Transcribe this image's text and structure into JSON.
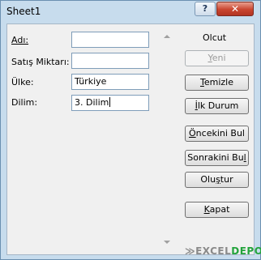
{
  "window": {
    "title": "Sheet1",
    "help_label": "?",
    "close_label": "✕"
  },
  "form": {
    "fields": [
      {
        "label": "Adı:",
        "value": ""
      },
      {
        "label": "Satış Miktarı:",
        "value": ""
      },
      {
        "label": "Ülke:",
        "value": "Türkiye"
      },
      {
        "label": "Dilim:",
        "value": "3. Dilim"
      }
    ]
  },
  "actions": {
    "group_label": "Olcut",
    "buttons": [
      {
        "pre": "",
        "key": "Y",
        "post": "eni",
        "enabled": false
      },
      {
        "pre": "",
        "key": "T",
        "post": "emizle",
        "enabled": true
      },
      {
        "pre": "",
        "key": "İ",
        "post": "lk Durum",
        "enabled": true
      },
      {
        "pre": "",
        "key": "Ö",
        "post": "ncekini Bul",
        "enabled": true
      },
      {
        "pre": "Sonrakini Bu",
        "key": "l",
        "post": "",
        "enabled": true
      },
      {
        "pre": "Olu",
        "key": "ş",
        "post": "tur",
        "enabled": true
      },
      {
        "pre": "",
        "key": "K",
        "post": "apat",
        "enabled": true
      }
    ]
  },
  "watermark": {
    "mark": "≫",
    "part1": "EXCEL",
    "part2": "DEPO"
  },
  "colors": {
    "frame": "#c7dced",
    "client": "#f0f0f0",
    "close_button": "#c9452f",
    "field_border": "#7f9db9"
  }
}
